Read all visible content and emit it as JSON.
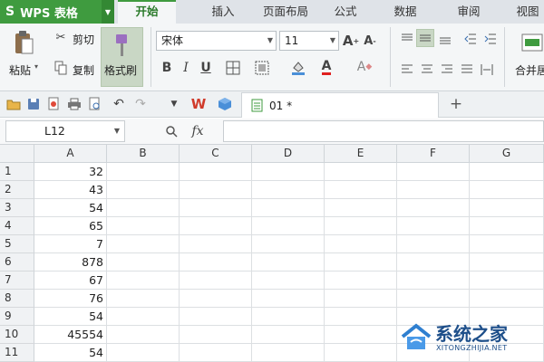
{
  "app": {
    "name": "WPS 表格",
    "logo": "S"
  },
  "menu_tabs": [
    "开始",
    "插入",
    "页面布局",
    "公式",
    "数据",
    "审阅",
    "视图"
  ],
  "active_tab": "开始",
  "ribbon": {
    "paste": "粘贴",
    "cut": "剪切",
    "copy": "复制",
    "format_painter": "格式刷",
    "font_name": "宋体",
    "font_size": "11",
    "merge_center": "合并居"
  },
  "document_tab": {
    "name": "01 *"
  },
  "formula_bar": {
    "cell_ref": "L12",
    "fx": "fx",
    "formula": ""
  },
  "columns": [
    "A",
    "B",
    "C",
    "D",
    "E",
    "F",
    "G"
  ],
  "rows": [
    {
      "num": "1",
      "A": "32"
    },
    {
      "num": "2",
      "A": "43"
    },
    {
      "num": "3",
      "A": "54"
    },
    {
      "num": "4",
      "A": "65"
    },
    {
      "num": "5",
      "A": "7"
    },
    {
      "num": "6",
      "A": "878"
    },
    {
      "num": "7",
      "A": "67"
    },
    {
      "num": "8",
      "A": "76"
    },
    {
      "num": "9",
      "A": "54"
    },
    {
      "num": "10",
      "A": "45554"
    },
    {
      "num": "11",
      "A": "54"
    }
  ],
  "watermark": {
    "title": "系统之家",
    "url": "XITONGZHIJIA.NET"
  },
  "colors": {
    "accent": "#3f9b3f",
    "selected": "#c9d7c5"
  }
}
